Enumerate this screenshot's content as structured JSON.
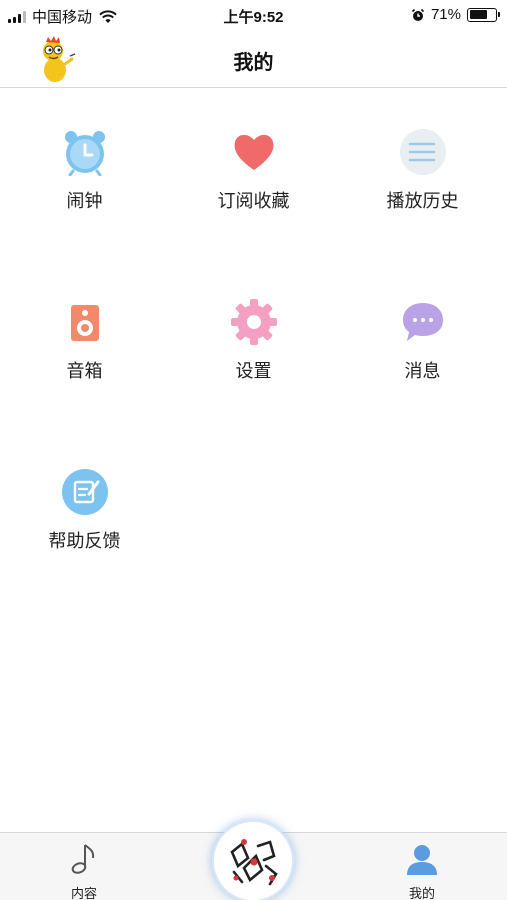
{
  "status_bar": {
    "carrier": "中国移动",
    "time": "上午9:52",
    "battery": "71%",
    "battery_level": 0.71
  },
  "header": {
    "title": "我的"
  },
  "menu": {
    "items": [
      {
        "label": "闹钟",
        "icon": "alarm-clock-icon",
        "color": "#7cc3ef"
      },
      {
        "label": "订阅收藏",
        "icon": "heart-icon",
        "color": "#f06a6a"
      },
      {
        "label": "播放历史",
        "icon": "list-icon",
        "color": "#9ec9ea"
      },
      {
        "label": "音箱",
        "icon": "speaker-icon",
        "color": "#f08a6b"
      },
      {
        "label": "设置",
        "icon": "gear-icon",
        "color": "#f4a0c2"
      },
      {
        "label": "消息",
        "icon": "chat-bubble-icon",
        "color": "#b9a2e6"
      },
      {
        "label": "帮助反馈",
        "icon": "edit-note-icon",
        "color": "#7cc3ef"
      }
    ]
  },
  "tabbar": {
    "tabs": [
      {
        "label": "内容",
        "icon": "music-note-icon"
      },
      {
        "label": "我的",
        "icon": "person-icon",
        "active_color": "#5b9be0"
      }
    ]
  }
}
